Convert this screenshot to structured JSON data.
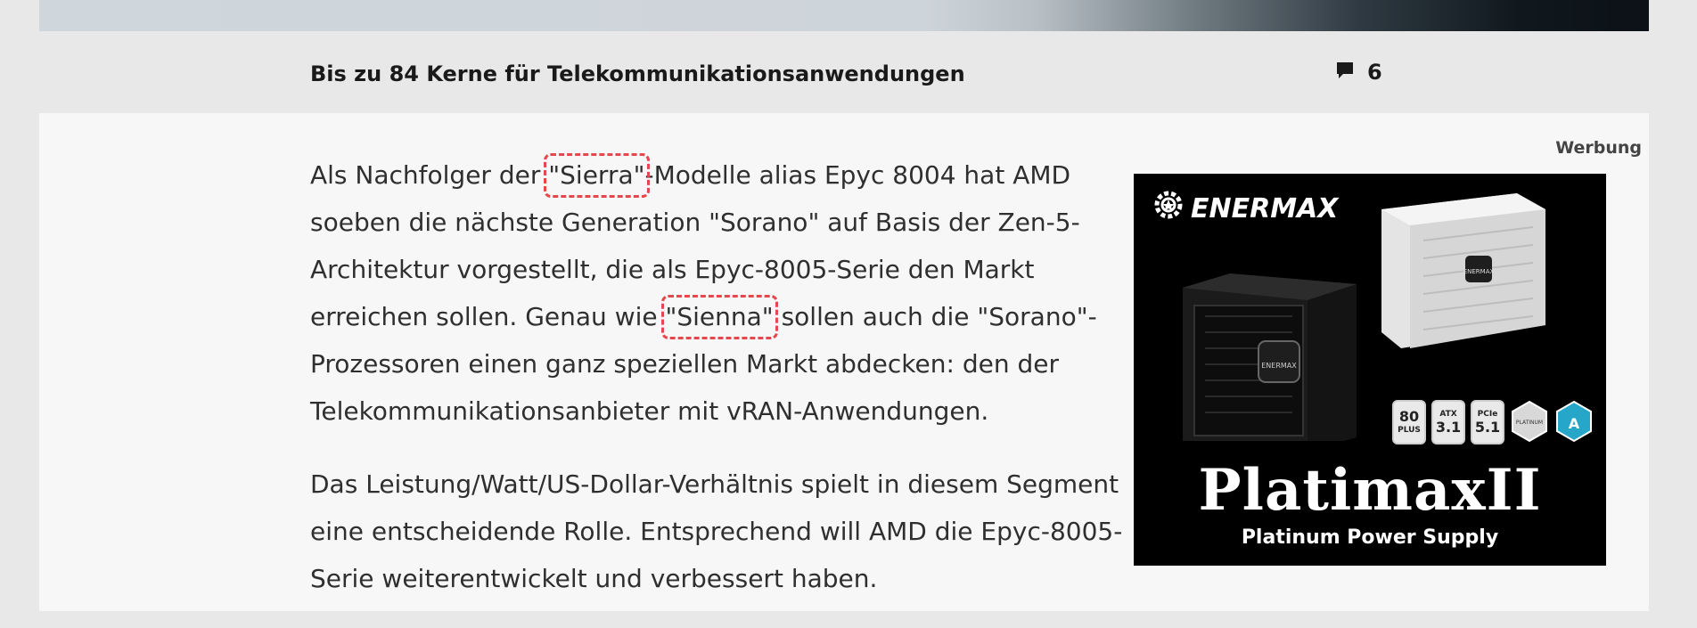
{
  "header": {
    "article_title": "Bis zu 84 Kerne für Telekommunikationsanwendungen",
    "comment_count": "6",
    "comment_icon": "speech-bubble-icon"
  },
  "article": {
    "p1": {
      "t1": "Als Nachfolger der ",
      "hl1": "\"Sierra\"",
      "t2": "-Modelle alias Epyc 8004 hat AMD soeben die nächste Generation \"Sorano\" auf Basis der Zen-5-Architektur vorgestellt, die als Epyc-8005-Serie den Markt erreichen sollen. Genau wie ",
      "hl2": "\"Sienna\"",
      "t3": " sollen auch die \"Sorano\"-Prozessoren einen ganz speziellen Markt abdecken: den der Telekommunikationsanbieter mit vRAN-Anwendungen."
    },
    "p2": "Das Leistung/Watt/US-Dollar-Verhältnis spielt in diesem Segment eine entscheidende Rolle. Entsprechend will AMD die Epyc-8005-Serie weiterentwickelt und verbessert haben."
  },
  "ad": {
    "label": "Werbung",
    "brand": "ENERMAX",
    "product": "PlatimaxII",
    "tagline": "Platinum Power Supply",
    "psu_logo_text": "ENERMAX",
    "badges": [
      {
        "top": "80",
        "bottom": "PLUS"
      },
      {
        "top": "ATX",
        "bottom": "3.1"
      },
      {
        "top": "PCIe",
        "bottom": "5.1"
      }
    ],
    "hex_badges": [
      "PLATINUM",
      "A"
    ]
  },
  "colors": {
    "highlight": "#e5474d",
    "page_bg": "#e8e8e8",
    "content_bg": "#f7f7f7",
    "ad_bg": "#000000",
    "hex_badge_cyan": "#26a7c9"
  }
}
